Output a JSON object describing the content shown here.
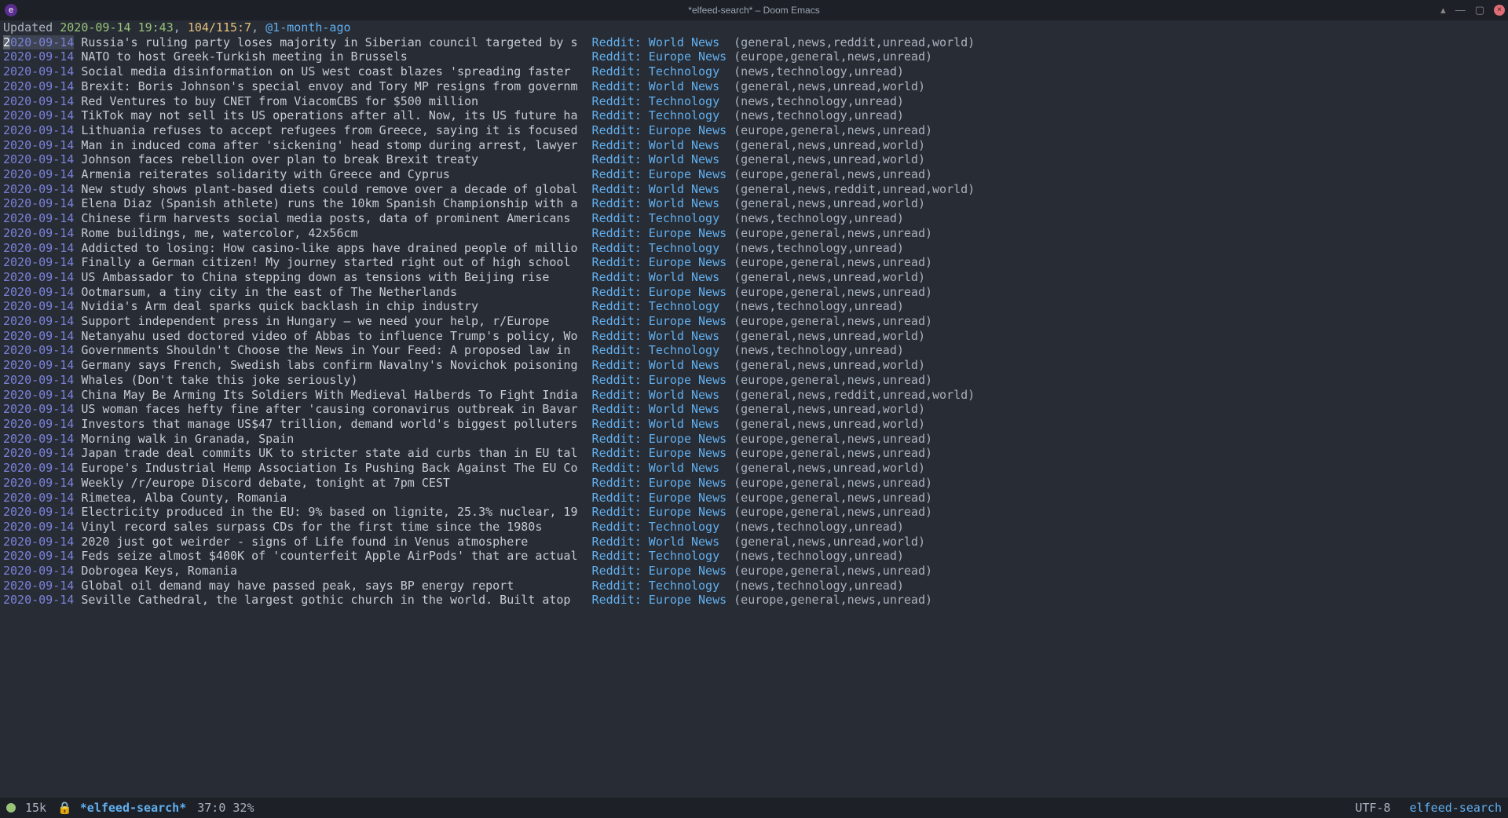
{
  "titlebar": {
    "title": "*elfeed-search* – Doom Emacs"
  },
  "header": {
    "updated_label": "Updated",
    "updated": "2020-09-14 19:43",
    "count": "104/115:7",
    "filter": "@1-month-ago"
  },
  "feeds": {
    "world": "Reddit: World News",
    "europe": "Reddit: Europe News",
    "tech": "Reddit: Technology"
  },
  "tagsets": {
    "world": "(general,news,reddit,unread,world)",
    "worldshort": "(general,news,unread,world)",
    "europe": "(europe,general,news,unread)",
    "tech": "(news,technology,unread)"
  },
  "entries": [
    {
      "date": "2020-09-14",
      "title": "Russia's ruling party loses majority in Siberian council targeted by s",
      "feed": "world",
      "tags": "world",
      "selected": true
    },
    {
      "date": "2020-09-14",
      "title": "NATO to host Greek-Turkish meeting in Brussels",
      "feed": "europe",
      "tags": "europe"
    },
    {
      "date": "2020-09-14",
      "title": "Social media disinformation on US west coast blazes 'spreading faster",
      "feed": "tech",
      "tags": "tech"
    },
    {
      "date": "2020-09-14",
      "title": "Brexit: Boris Johnson's special envoy and Tory MP resigns from governm",
      "feed": "world",
      "tags": "worldshort"
    },
    {
      "date": "2020-09-14",
      "title": "Red Ventures to buy CNET from ViacomCBS for $500 million",
      "feed": "tech",
      "tags": "tech"
    },
    {
      "date": "2020-09-14",
      "title": "TikTok may not sell its US operations after all. Now, its US future ha",
      "feed": "tech",
      "tags": "tech"
    },
    {
      "date": "2020-09-14",
      "title": "Lithuania refuses to accept refugees from Greece, saying it is focused",
      "feed": "europe",
      "tags": "europe"
    },
    {
      "date": "2020-09-14",
      "title": "Man in induced coma after 'sickening' head stomp during arrest, lawyer",
      "feed": "world",
      "tags": "worldshort"
    },
    {
      "date": "2020-09-14",
      "title": "Johnson faces rebellion over plan to break Brexit treaty",
      "feed": "world",
      "tags": "worldshort"
    },
    {
      "date": "2020-09-14",
      "title": "Armenia reiterates solidarity with Greece and Cyprus",
      "feed": "europe",
      "tags": "europe"
    },
    {
      "date": "2020-09-14",
      "title": "New study shows plant-based diets could remove over a decade of global",
      "feed": "world",
      "tags": "world"
    },
    {
      "date": "2020-09-14",
      "title": "Elena Diaz (Spanish athlete) runs the 10km Spanish Championship with a",
      "feed": "world",
      "tags": "worldshort"
    },
    {
      "date": "2020-09-14",
      "title": "Chinese firm harvests social media posts, data of prominent Americans",
      "feed": "tech",
      "tags": "tech"
    },
    {
      "date": "2020-09-14",
      "title": "Rome buildings, me, watercolor, 42x56cm",
      "feed": "europe",
      "tags": "europe"
    },
    {
      "date": "2020-09-14",
      "title": "Addicted to losing: How casino-like apps have drained people of millio",
      "feed": "tech",
      "tags": "tech"
    },
    {
      "date": "2020-09-14",
      "title": "Finally a German citizen! My journey started right out of high school",
      "feed": "europe",
      "tags": "europe"
    },
    {
      "date": "2020-09-14",
      "title": "US Ambassador to China stepping down as tensions with Beijing rise",
      "feed": "world",
      "tags": "worldshort"
    },
    {
      "date": "2020-09-14",
      "title": "Ootmarsum, a tiny city in the east of The Netherlands",
      "feed": "europe",
      "tags": "europe"
    },
    {
      "date": "2020-09-14",
      "title": "Nvidia's Arm deal sparks quick backlash in chip industry",
      "feed": "tech",
      "tags": "tech"
    },
    {
      "date": "2020-09-14",
      "title": "Support independent press in Hungary – we need your help, r/Europe",
      "feed": "europe",
      "tags": "europe"
    },
    {
      "date": "2020-09-14",
      "title": "Netanyahu used doctored video of Abbas to influence Trump's policy, Wo",
      "feed": "world",
      "tags": "worldshort"
    },
    {
      "date": "2020-09-14",
      "title": "Governments Shouldn't Choose the News in Your Feed: A proposed law in",
      "feed": "tech",
      "tags": "tech"
    },
    {
      "date": "2020-09-14",
      "title": "Germany says French, Swedish labs confirm Navalny's Novichok poisoning",
      "feed": "world",
      "tags": "worldshort"
    },
    {
      "date": "2020-09-14",
      "title": "Whales (Don't take this joke seriously)",
      "feed": "europe",
      "tags": "europe"
    },
    {
      "date": "2020-09-14",
      "title": "China May Be Arming Its Soldiers With Medieval Halberds To Fight India",
      "feed": "world",
      "tags": "world"
    },
    {
      "date": "2020-09-14",
      "title": "US woman faces hefty fine after 'causing coronavirus outbreak in Bavar",
      "feed": "world",
      "tags": "worldshort"
    },
    {
      "date": "2020-09-14",
      "title": "Investors that manage US$47 trillion, demand world's biggest polluters",
      "feed": "world",
      "tags": "worldshort"
    },
    {
      "date": "2020-09-14",
      "title": "Morning walk in Granada, Spain",
      "feed": "europe",
      "tags": "europe"
    },
    {
      "date": "2020-09-14",
      "title": "Japan trade deal commits UK to stricter state aid curbs than in EU tal",
      "feed": "europe",
      "tags": "europe"
    },
    {
      "date": "2020-09-14",
      "title": "Europe's Industrial Hemp Association Is Pushing Back Against The EU Co",
      "feed": "world",
      "tags": "worldshort"
    },
    {
      "date": "2020-09-14",
      "title": "Weekly /r/europe Discord debate, tonight at 7pm CEST",
      "feed": "europe",
      "tags": "europe"
    },
    {
      "date": "2020-09-14",
      "title": "Rimetea, Alba County, Romania",
      "feed": "europe",
      "tags": "europe"
    },
    {
      "date": "2020-09-14",
      "title": "Electricity produced in the EU: 9% based on lignite, 25.3% nuclear, 19",
      "feed": "europe",
      "tags": "europe"
    },
    {
      "date": "2020-09-14",
      "title": "Vinyl record sales surpass CDs for the first time since the 1980s",
      "feed": "tech",
      "tags": "tech"
    },
    {
      "date": "2020-09-14",
      "title": "2020 just got weirder - signs of Life found in Venus atmosphere",
      "feed": "world",
      "tags": "worldshort"
    },
    {
      "date": "2020-09-14",
      "title": "Feds seize almost $400K of 'counterfeit Apple AirPods' that are actual",
      "feed": "tech",
      "tags": "tech"
    },
    {
      "date": "2020-09-14",
      "title": "Dobrogea Keys, Romania",
      "feed": "europe",
      "tags": "europe"
    },
    {
      "date": "2020-09-14",
      "title": "Global oil demand may have passed peak, says BP energy report",
      "feed": "tech",
      "tags": "tech"
    },
    {
      "date": "2020-09-14",
      "title": "Seville Cathedral, the largest gothic church in the world. Built atop",
      "feed": "europe",
      "tags": "europe"
    }
  ],
  "modeline": {
    "size": "15k",
    "lock_icon": "🔒",
    "buffer": "*elfeed-search*",
    "pos": "37:0 32%",
    "encoding": "UTF-8",
    "major_mode": "elfeed-search"
  }
}
